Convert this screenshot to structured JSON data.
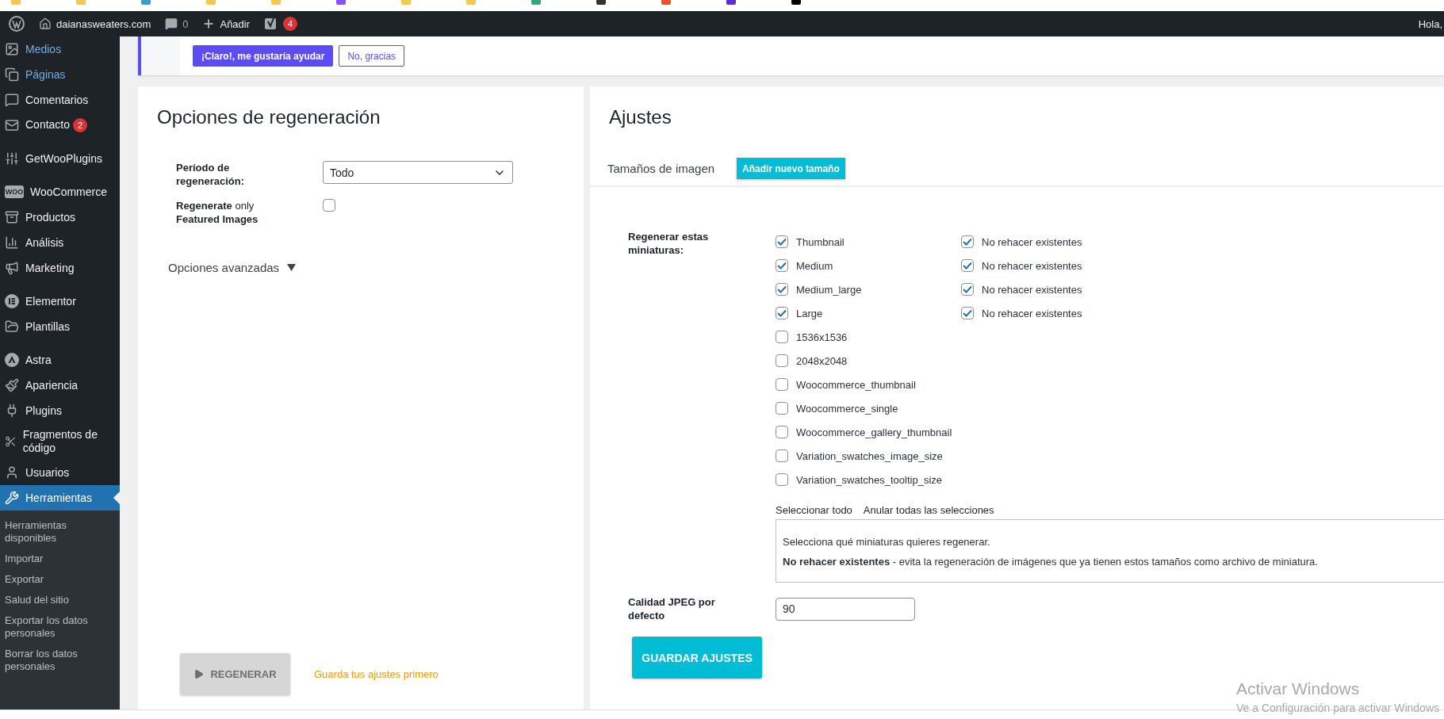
{
  "admin_bar": {
    "site": "daianasweaters.com",
    "comments": "0",
    "new": "Añadir",
    "seo_badge": "4",
    "greeting": "Hola,"
  },
  "sidebar": {
    "groups": [
      [
        {
          "label": "Medios",
          "highlighted": true,
          "selected": false
        },
        {
          "label": "Páginas",
          "highlighted": true,
          "selected": false
        },
        {
          "label": "Comentarios",
          "highlighted": false,
          "selected": false
        },
        {
          "label": "Contacto",
          "highlighted": false,
          "selected": false,
          "badge": "2"
        }
      ],
      [
        {
          "label": "GetWooPlugins",
          "highlighted": false,
          "selected": false
        }
      ],
      [
        {
          "label": "WooCommerce",
          "highlighted": false,
          "selected": false,
          "icon_text": "WOO"
        },
        {
          "label": "Productos",
          "highlighted": false,
          "selected": false
        },
        {
          "label": "Análisis",
          "highlighted": false,
          "selected": false
        },
        {
          "label": "Marketing",
          "highlighted": false,
          "selected": false
        }
      ],
      [
        {
          "label": "Elementor",
          "highlighted": false,
          "selected": false
        },
        {
          "label": "Plantillas",
          "highlighted": false,
          "selected": false
        }
      ],
      [
        {
          "label": "Astra",
          "highlighted": false,
          "selected": false
        },
        {
          "label": "Apariencia",
          "highlighted": false,
          "selected": false
        },
        {
          "label": "Plugins",
          "highlighted": false,
          "selected": false
        },
        {
          "label": "Fragmentos de código",
          "highlighted": false,
          "selected": false
        },
        {
          "label": "Usuarios",
          "highlighted": false,
          "selected": false
        },
        {
          "label": "Herramientas",
          "highlighted": false,
          "selected": true
        }
      ]
    ],
    "submenu": [
      {
        "label": "Herramientas disponibles",
        "selected": false
      },
      {
        "label": "Importar",
        "selected": false
      },
      {
        "label": "Exportar",
        "selected": false
      },
      {
        "label": "Salud del sitio",
        "selected": false
      },
      {
        "label": "Exportar los datos personales",
        "selected": false
      },
      {
        "label": "Borrar los datos personales",
        "selected": false
      }
    ]
  },
  "notice": {
    "buttons": [
      {
        "label": "¡Claro!, me gustaría ayudar",
        "kind": "primary"
      },
      {
        "label": "No, gracias",
        "kind": "secondary"
      }
    ]
  },
  "regeneration": {
    "title": "Opciones de regeneración",
    "fields": [
      {
        "kind": "select",
        "label": "Período de regeneración:",
        "value": "Todo"
      },
      {
        "kind": "checkbox",
        "label": "**Regenerate** only **Featured Images**",
        "checked": false
      }
    ],
    "advanced": "Opciones avanzadas",
    "regenerate_button": {
      "label": "REGENERAR",
      "disabled": true
    },
    "hint": "Guarda tus ajustes primero"
  },
  "settings": {
    "title": "Ajustes",
    "tab": "Tamaños de imagen",
    "add_button": "Añadir nuevo tamaño",
    "sizes_label": "Regenerar estas miniaturas:",
    "sizes": [
      {
        "label": "Thumbnail",
        "checked": true,
        "skip_existing": {
          "label": "No rehacer existentes",
          "checked": true
        }
      },
      {
        "label": "Medium",
        "checked": true,
        "skip_existing": {
          "label": "No rehacer existentes",
          "checked": true
        }
      },
      {
        "label": "Medium_large",
        "checked": true,
        "skip_existing": {
          "label": "No rehacer existentes",
          "checked": true
        }
      },
      {
        "label": "Large",
        "checked": true,
        "skip_existing": {
          "label": "No rehacer existentes",
          "checked": true
        }
      },
      {
        "label": "1536x1536",
        "checked": false
      },
      {
        "label": "2048x2048",
        "checked": false
      },
      {
        "label": "Woocommerce_thumbnail",
        "checked": false
      },
      {
        "label": "Woocommerce_single",
        "checked": false
      },
      {
        "label": "Woocommerce_gallery_thumbnail",
        "checked": false
      },
      {
        "label": "Variation_swatches_image_size",
        "checked": false
      },
      {
        "label": "Variation_swatches_tooltip_size",
        "checked": false
      }
    ],
    "links": [
      "Seleccionar todo",
      "Anular todas las selecciones"
    ],
    "description": [
      "Selecciona qué miniaturas quieres regenerar.",
      "**No rehacer existentes** - evita la regeneración de imágenes que ya tienen estos tamaños como archivo de miniatura."
    ],
    "jpeg": {
      "label": "Calidad JPEG por defecto",
      "value": "90"
    },
    "save_button": "GUARDAR AJUSTES"
  },
  "os_overlay": {
    "title": "Activar Windows",
    "subtitle": "Ve a Configuración para activar Windows"
  }
}
